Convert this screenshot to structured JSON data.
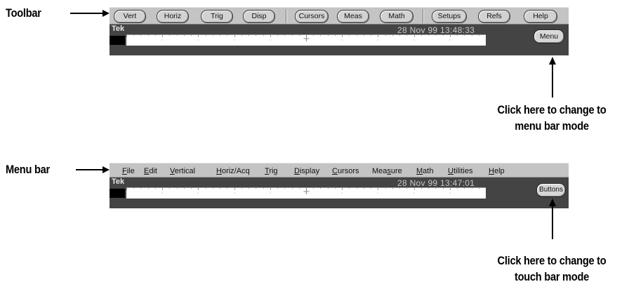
{
  "callouts": {
    "toolbar": "Toolbar",
    "menu_bar": "Menu bar",
    "menu_mode_note_line1": "Click here to change to",
    "menu_mode_note_line2": "menu bar mode",
    "touch_mode_note_line1": "Click here to change to",
    "touch_mode_note_line2": "touch bar mode"
  },
  "toolbar_panel": {
    "buttons": [
      "Vert",
      "Horiz",
      "Trig",
      "Disp",
      "Cursors",
      "Meas",
      "Math",
      "Setups",
      "Refs",
      "Help"
    ],
    "brand": "Tek",
    "datetime": "28 Nov 99 13:48:33",
    "mode_button": "Menu"
  },
  "menubar_panel": {
    "items": [
      {
        "u": "F",
        "rest": "ile"
      },
      {
        "u": "E",
        "rest": "dit"
      },
      {
        "u": "V",
        "rest": "ertical"
      },
      {
        "u": "H",
        "rest": "oriz/Acq"
      },
      {
        "u": "T",
        "rest": "rig"
      },
      {
        "u": "D",
        "rest": "isplay"
      },
      {
        "u": "C",
        "rest": "ursors"
      },
      {
        "pre": "Mea",
        "u": "s",
        "rest": "ure"
      },
      {
        "u": "M",
        "rest": "ath"
      },
      {
        "u": "U",
        "rest": "tilities"
      },
      {
        "u": "H",
        "rest": "elp"
      }
    ],
    "brand": "Tek",
    "datetime": "28 Nov 99 13:47:01",
    "mode_button": "Buttons"
  },
  "colors": {
    "bar": "#c4c4c4",
    "screen": "#444444",
    "text": "#000000"
  }
}
